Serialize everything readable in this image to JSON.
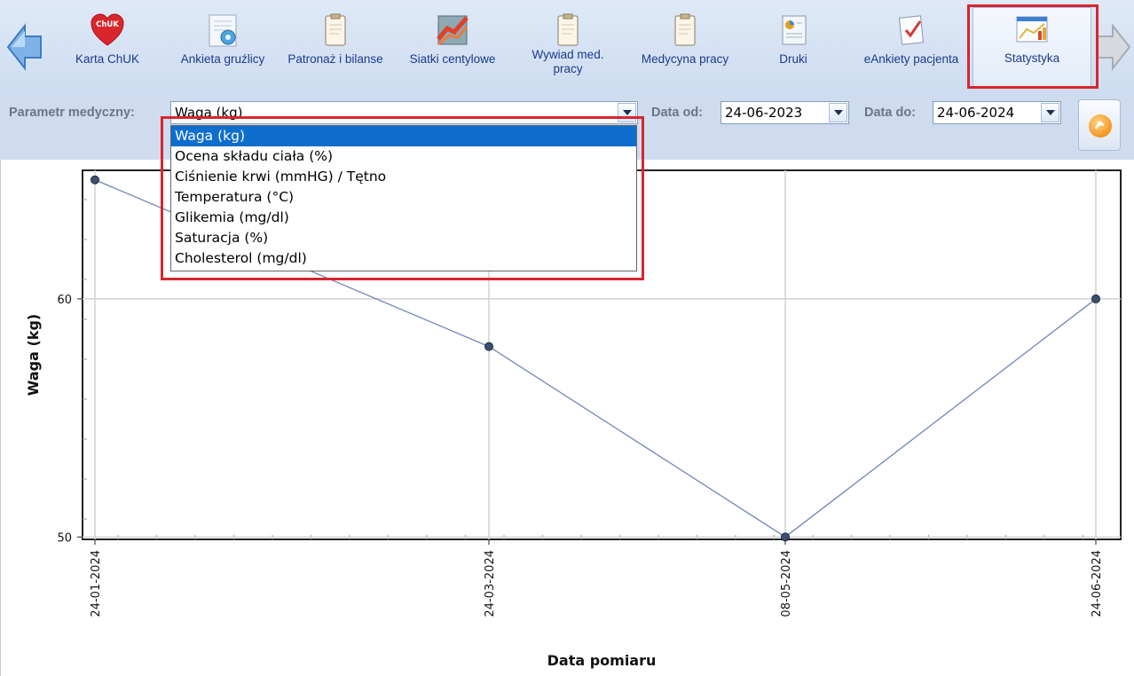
{
  "toolbar": {
    "items": [
      {
        "label": "Karta ChUK",
        "icon_text": "ChUK",
        "icon": "heart-chuk-icon"
      },
      {
        "label": "Ankieta gruźlicy",
        "icon": "lung-survey-icon"
      },
      {
        "label": "Patronaż i bilanse",
        "icon": "clipboard-icon"
      },
      {
        "label": "Siatki centylowe",
        "icon": "centile-grid-icon"
      },
      {
        "label": "Wywiad med. pracy",
        "icon": "clipboard-icon"
      },
      {
        "label": "Medycyna pracy",
        "icon": "clipboard-icon"
      },
      {
        "label": "Druki",
        "icon": "print-doc-icon"
      },
      {
        "label": "eAnkiety pacjenta",
        "icon": "e-survey-icon"
      },
      {
        "label": "Statystyka",
        "icon": "statistics-icon",
        "active": true
      }
    ]
  },
  "filters": {
    "param_label": "Parametr medyczny:",
    "param_value": "Waga (kg)",
    "date_from_label": "Data od:",
    "date_from": "24-06-2023",
    "date_to_label": "Data do:",
    "date_to": "24-06-2024"
  },
  "dropdown": {
    "options": [
      "Waga (kg)",
      "Ocena składu ciała (%)",
      "Ciśnienie krwi (mmHG) / Tętno",
      "Temperatura (°C)",
      "Glikemia (mg/dl)",
      "Saturacja (%)",
      "Cholesterol (mg/dl)"
    ],
    "selected_index": 0
  },
  "colors": {
    "highlight": "#d8252f",
    "line": "#6f86b8",
    "marker": "#3c4f6f",
    "selected_option": "#0f6ecd"
  },
  "chart_data": {
    "type": "line",
    "xlabel": "Data pomiaru",
    "ylabel": "Waga (kg)",
    "x": [
      "24-01-2024",
      "24-03-2024",
      "08-05-2024",
      "24-06-2024"
    ],
    "series": [
      {
        "values": [
          65,
          58,
          50,
          60
        ]
      }
    ],
    "yticks": [
      50,
      60
    ],
    "ylim": [
      49.9,
      65.4
    ],
    "grid": true
  }
}
